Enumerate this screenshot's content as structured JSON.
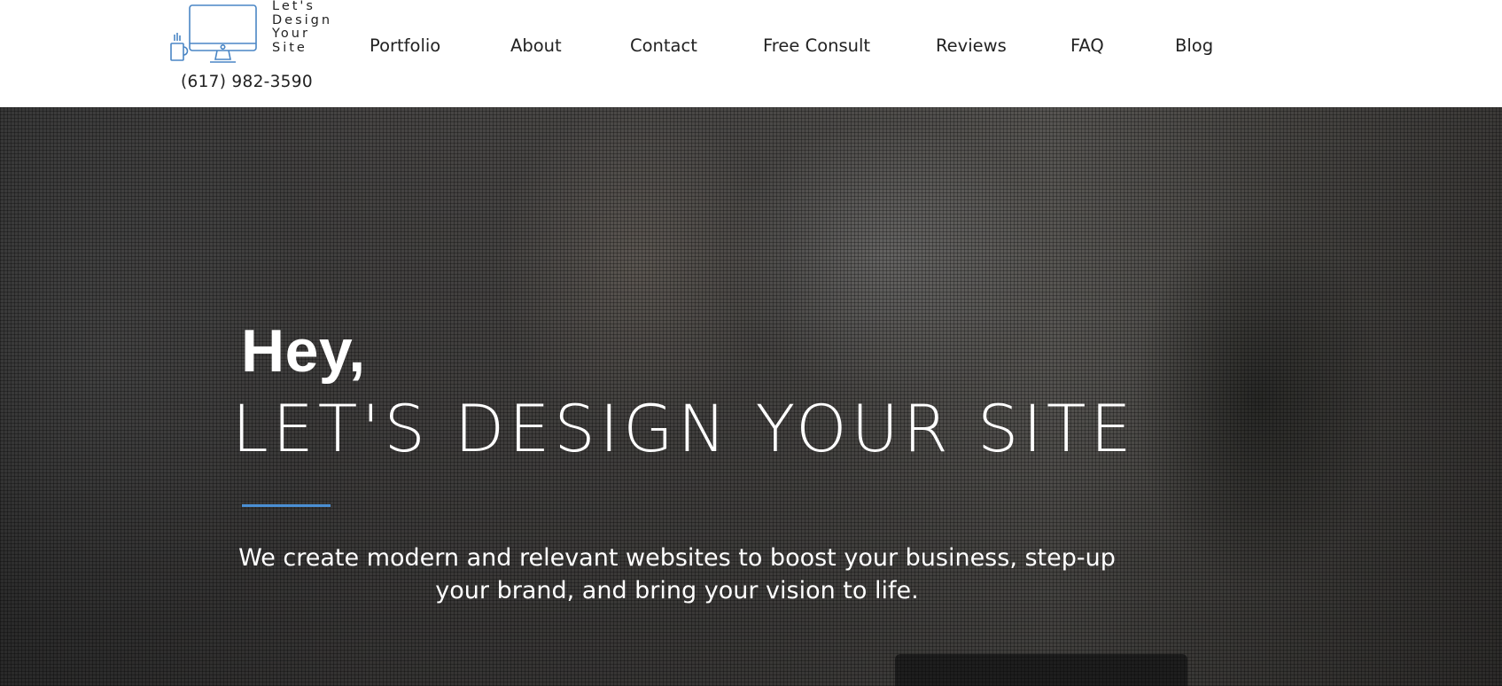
{
  "brand": {
    "logo_text": "Let's\nDesign\nYour\nSite",
    "phone": "(617) 982-3590",
    "accent_color": "#4a8fd4"
  },
  "nav": {
    "items": [
      {
        "label": "Portfolio"
      },
      {
        "label": "About"
      },
      {
        "label": "Contact"
      },
      {
        "label": "Free Consult"
      },
      {
        "label": "Reviews"
      },
      {
        "label": "FAQ"
      },
      {
        "label": "Blog"
      }
    ]
  },
  "hero": {
    "greeting": "Hey,",
    "title": "LET'S DESIGN YOUR SITE",
    "subtitle_line1": "We create modern and relevant websites to boost your business, step-up",
    "subtitle_line2": "your brand, and bring your vision to life."
  },
  "icons": {
    "logo": "monitor-with-coffee-mug-icon"
  }
}
